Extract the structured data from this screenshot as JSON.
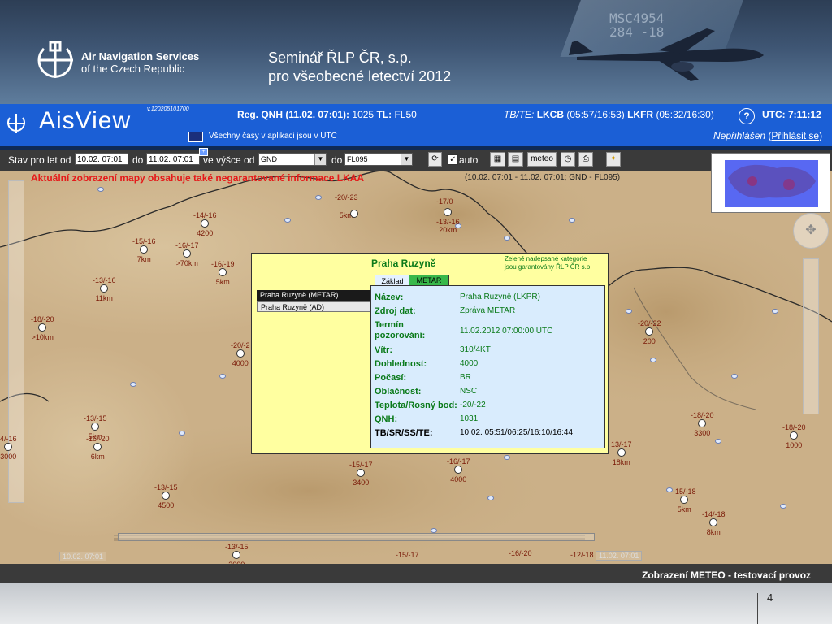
{
  "slide": {
    "org_line1": "Air Navigation Services",
    "org_line2": "of the Czech Republic",
    "seminar_line1": "Seminář ŘLP ČR, s.p.",
    "seminar_line2": "pro všeobecné letectví 2012",
    "tail_line1": "MSC4954",
    "tail_line2": "284 -18",
    "page_number": "4"
  },
  "appbar": {
    "title": "AisView",
    "version": "v.120205101700",
    "qnh_label": "Reg. QNH (11.02. 07:01):",
    "qnh_value": "1025",
    "tl_label": "TL:",
    "tl_value": "FL50",
    "tbte_label": "TB/TE:",
    "tbte_value1": "LKCB",
    "tbte_time1": "(05:57/16:53)",
    "tbte_value2": "LKFR",
    "tbte_time2": "(05:32/16:30)",
    "help_symbol": "?",
    "utc": "UTC:  7:11:12",
    "times_note": "Všechny časy v aplikaci jsou v UTC",
    "login_status": "Nepřihlášen",
    "login_link": "Přihlásit se"
  },
  "toolbar": {
    "from_label": "Stav pro let od",
    "from_value": "10.02. 07:01",
    "to_label": "do",
    "to_value": "11.02. 07:01",
    "alt_label": "ve výšce od",
    "alt_from": "GND",
    "alt_to_label": "do",
    "alt_to": "FL095",
    "auto_label": "auto",
    "auto_checked": true,
    "meteo_label": "meteo"
  },
  "map": {
    "warning": "Aktuální zobrazení mapy obsahuje také negarantované informace LKAA",
    "range": "(10.02. 07:01 - 11.02. 07:01; GND - FL095)",
    "time_left": "10.02. 07:01",
    "time_right": "11.02. 07:01",
    "stations": [
      {
        "t": "-20/-23",
        "v": "5km"
      },
      {
        "t": "-17/0",
        "v": ""
      },
      {
        "t": "-13/-16",
        "v": "20km"
      },
      {
        "t": "-14/-16",
        "v": "4200"
      },
      {
        "t": "-15/-16",
        "v": "7km"
      },
      {
        "t": "-16/-17",
        "v": ">70km"
      },
      {
        "t": "-16/-19",
        "v": "5km"
      },
      {
        "t": "-13/-16",
        "v": "11km"
      },
      {
        "t": "-18/-20",
        "v": ">10km"
      },
      {
        "t": "-20/-2",
        "v": "4000"
      },
      {
        "t": "-20/-22",
        "v": "200"
      },
      {
        "t": "-18/-20",
        "v": "3300"
      },
      {
        "t": "-18/-20",
        "v": "1000"
      },
      {
        "t": "-13/-15",
        "v": "5km"
      },
      {
        "t": "-16/-20",
        "v": "6km"
      },
      {
        "t": "4/-16",
        "v": "3000"
      },
      {
        "t": "-15/-17",
        "v": "3400"
      },
      {
        "t": "-16/-17",
        "v": "4000"
      },
      {
        "t": "13/-17",
        "v": "18km"
      },
      {
        "t": "-13/-15",
        "v": "4500"
      },
      {
        "t": "-15/-18",
        "v": "5km"
      },
      {
        "t": "-14/-18",
        "v": "8km"
      },
      {
        "t": "-13/-15",
        "v": "3000"
      },
      {
        "t": "-15/-17",
        "v": ""
      },
      {
        "t": "-16/-20",
        "v": ""
      },
      {
        "t": "-12/-18",
        "v": ""
      }
    ]
  },
  "popup": {
    "title": "Praha Ruzyně",
    "note_line1": "Zeleně nadepsané kategorie",
    "note_line2": "jsou garantovány ŘLP ČR s.p.",
    "list": [
      "Praha Ruzyně (METAR)",
      "Praha Ruzyně (AD)"
    ],
    "tabs": [
      "Základ",
      "METAR"
    ],
    "rows": [
      {
        "k": "Název:",
        "v": "Praha Ruzyně (LKPR)",
        "green": true
      },
      {
        "k": "Zdroj dat:",
        "v": "Zpráva METAR",
        "green": true
      },
      {
        "k": "Termín pozorování:",
        "v": "11.02.2012 07:00:00 UTC",
        "green": true
      },
      {
        "k": "Vítr:",
        "v": "310/4KT",
        "green": true
      },
      {
        "k": "Dohlednost:",
        "v": "4000",
        "green": true
      },
      {
        "k": "Počasí:",
        "v": "BR",
        "green": true
      },
      {
        "k": "Oblačnost:",
        "v": "NSC",
        "green": true
      },
      {
        "k": "Teplota/Rosný bod:",
        "v": "-20/-22",
        "green": true
      },
      {
        "k": "QNH:",
        "v": "1031",
        "green": true
      },
      {
        "k": "TB/SR/SS/TE:",
        "v": "10.02. 05:51/06:25/16:10/16:44",
        "green": false
      }
    ]
  },
  "footer": {
    "status": "Zobrazení METEO - testovací provoz"
  }
}
